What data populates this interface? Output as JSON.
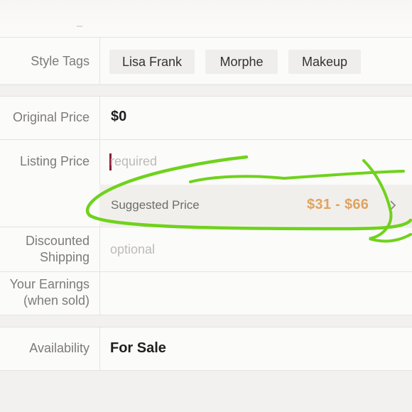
{
  "style_tags": {
    "label": "Style Tags",
    "tags": [
      "Lisa Frank",
      "Morphe",
      "Makeup"
    ]
  },
  "original_price": {
    "label": "Original Price",
    "value": "$0"
  },
  "listing_price": {
    "label": "Listing Price",
    "placeholder": "required"
  },
  "suggested_price": {
    "label": "Suggested Price",
    "range": "$31 - $66",
    "chevron_icon": "chevron-right-icon"
  },
  "discounted_shipping": {
    "label_line1": "Discounted",
    "label_line2": "Shipping",
    "placeholder": "optional"
  },
  "your_earnings": {
    "label_line1": "Your Earnings",
    "label_line2": "(when sold)"
  },
  "availability": {
    "label": "Availability",
    "value": "For Sale"
  },
  "colors": {
    "accent_price": "#e0a35f",
    "cursor": "#8a1c35",
    "annotation": "#6fd21c"
  }
}
